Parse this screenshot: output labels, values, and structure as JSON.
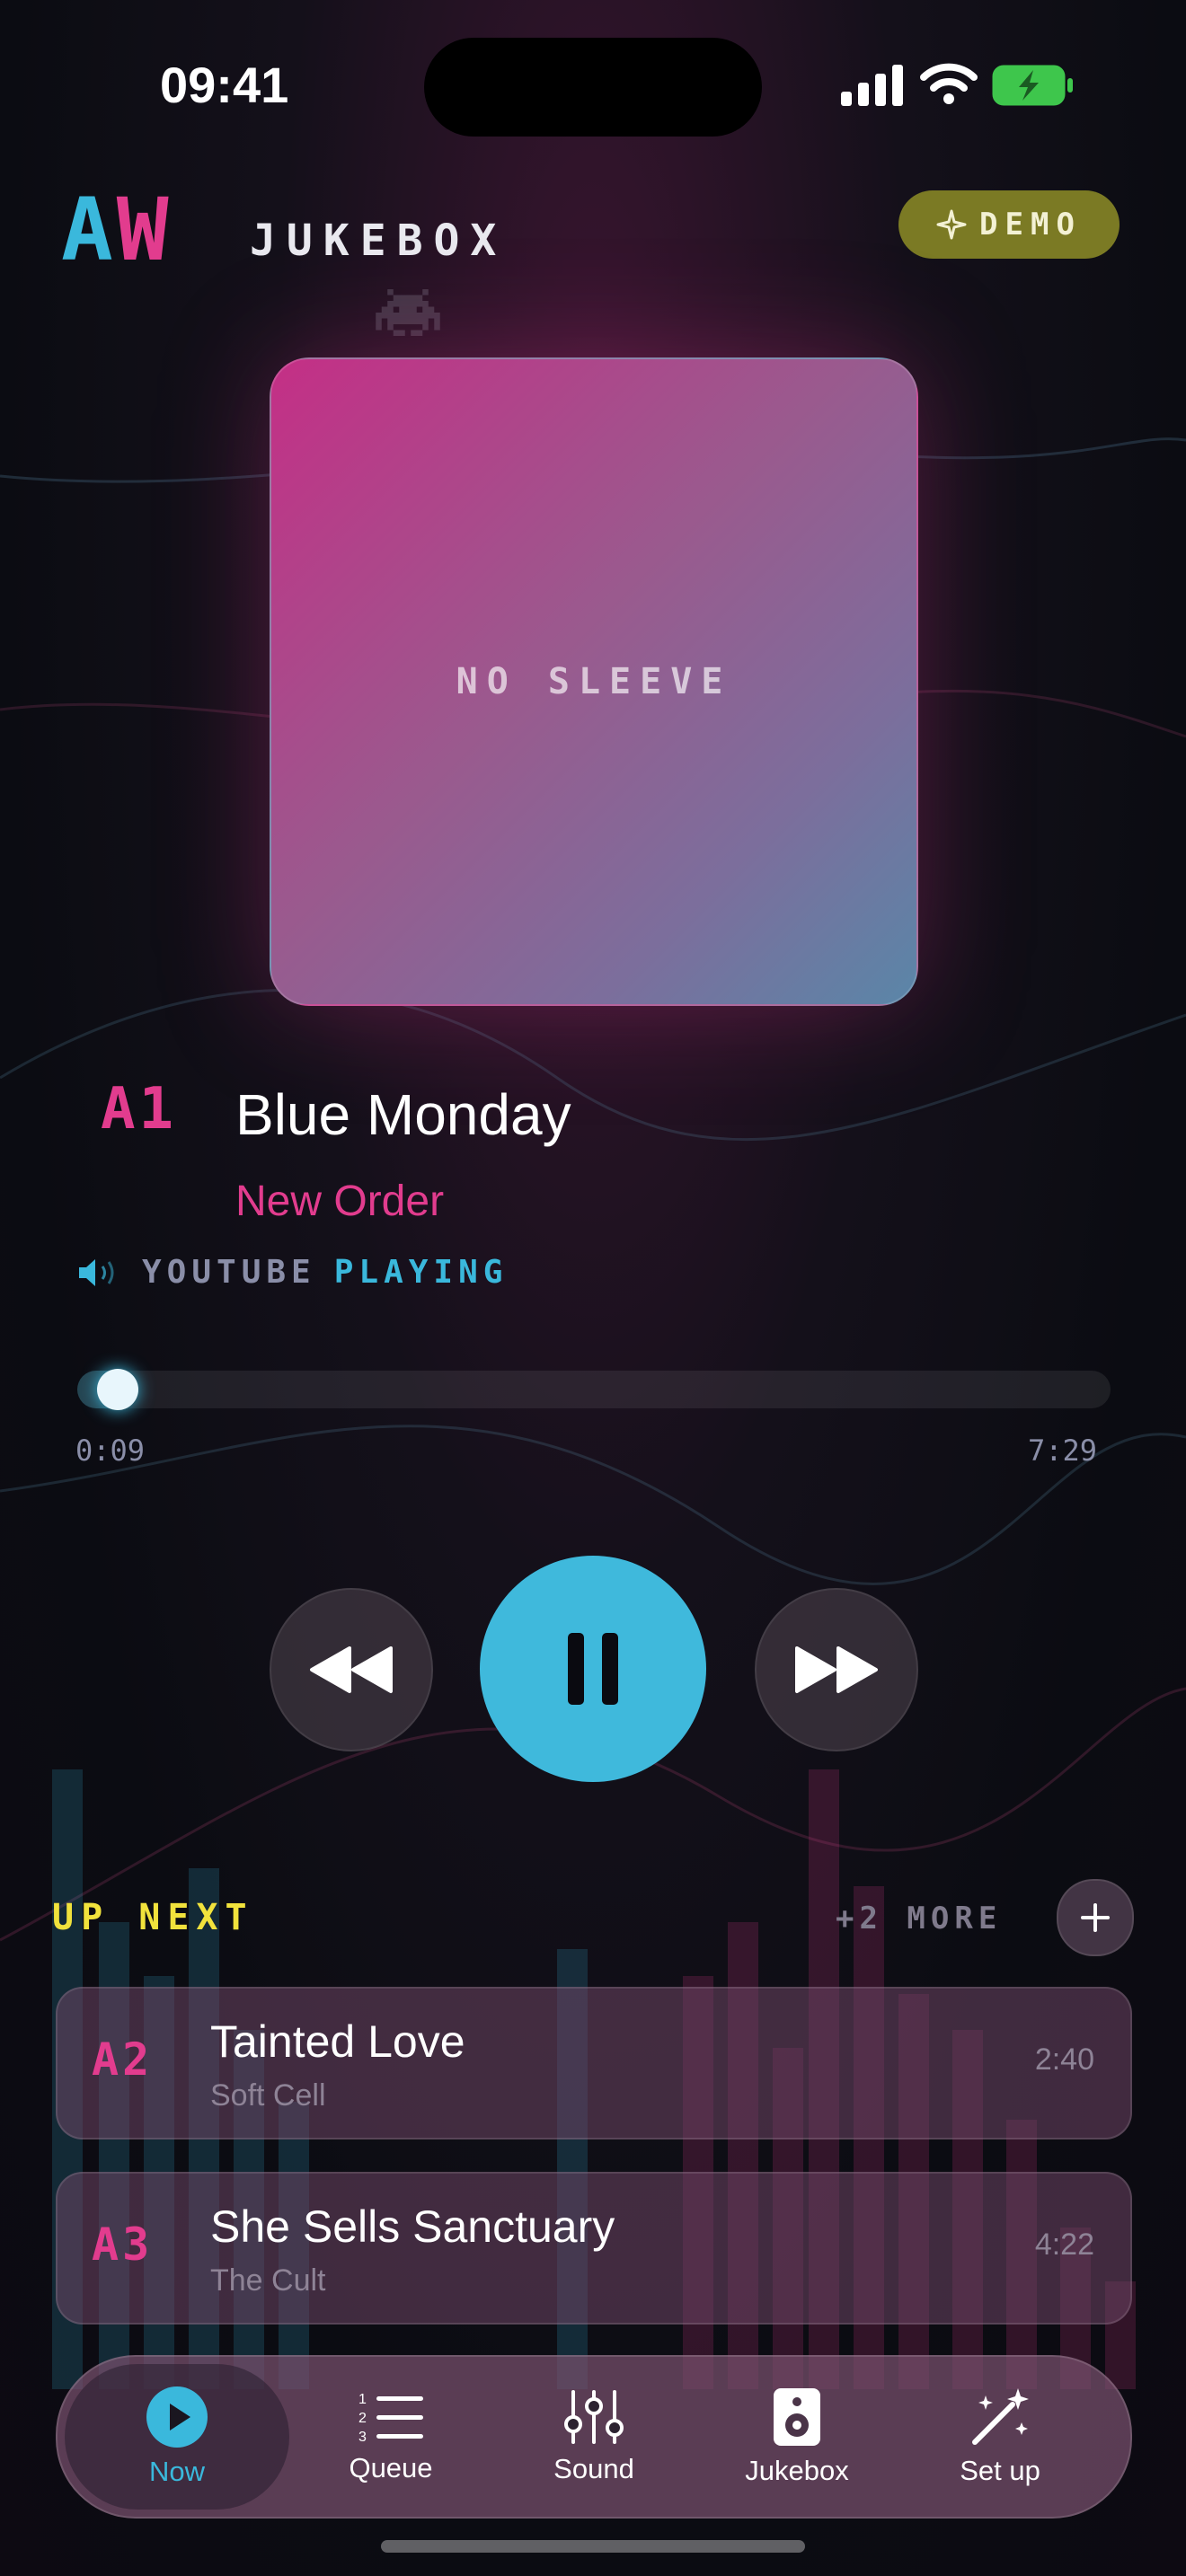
{
  "status_bar": {
    "time": "09:41"
  },
  "header": {
    "logo_a": "A",
    "logo_w": "W",
    "logo_text": "JUKEBOX",
    "demo_label": "DEMO"
  },
  "now_playing": {
    "sleeve_label": "NO SLEEVE",
    "code": "A1",
    "title": "Blue Monday",
    "artist": "New Order",
    "source_label": "YOUTUBE",
    "source_state": "PLAYING",
    "elapsed": "0:09",
    "total": "7:29",
    "progress": 0.02
  },
  "up_next": {
    "title": "UP NEXT",
    "more_label": "+2 MORE",
    "items": [
      {
        "code": "A2",
        "title": "Tainted Love",
        "artist": "Soft Cell",
        "duration": "2:40"
      },
      {
        "code": "A3",
        "title": "She Sells Sanctuary",
        "artist": "The Cult",
        "duration": "4:22"
      }
    ]
  },
  "tabs": [
    {
      "label": "Now",
      "icon": "play-circle-icon"
    },
    {
      "label": "Queue",
      "icon": "numbered-list-icon"
    },
    {
      "label": "Sound",
      "icon": "sliders-icon"
    },
    {
      "label": "Jukebox",
      "icon": "speaker-icon"
    },
    {
      "label": "Set up",
      "icon": "magic-wand-icon"
    }
  ],
  "colors": {
    "accent_cyan": "#3ab8dc",
    "accent_pink": "#e23c8e",
    "accent_yellow": "#f1e23c",
    "demo_olive": "#7b7a24"
  }
}
